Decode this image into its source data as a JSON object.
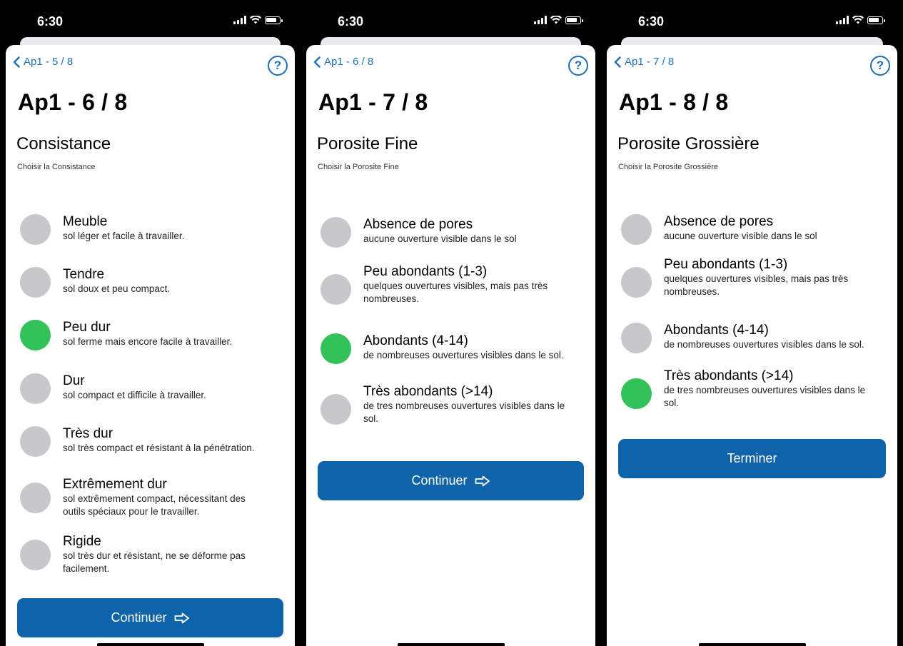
{
  "status": {
    "time": "6:30"
  },
  "screens": [
    {
      "back_label": "Ap1 - 5 / 8",
      "help_label": "?",
      "title": "Ap1 - 6 / 8",
      "section_title": "Consistance",
      "section_subtitle": "Choisir la Consistance",
      "button_label": "Continuer",
      "selected_option": "Peu dur",
      "options": [
        {
          "label": "Meuble",
          "desc": "sol léger et facile à travailler."
        },
        {
          "label": "Tendre",
          "desc": "sol doux et peu compact."
        },
        {
          "label": "Peu dur",
          "desc": "sol ferme mais encore facile à travailler."
        },
        {
          "label": "Dur",
          "desc": "sol compact et difficile à travailler."
        },
        {
          "label": "Très dur",
          "desc": "sol très compact et résistant à la pénétration."
        },
        {
          "label": "Extrêmement dur",
          "desc": "sol extrêmement compact, nécessitant des outils spéciaux pour le travailler."
        },
        {
          "label": "Rigide",
          "desc": "sol très dur et résistant, ne se déforme pas facilement."
        }
      ]
    },
    {
      "back_label": "Ap1 - 6 / 8",
      "help_label": "?",
      "title": "Ap1 - 7 / 8",
      "section_title": "Porosite Fine",
      "section_subtitle": "Choisir la Porosite Fine",
      "button_label": "Continuer",
      "selected_option": "Abondants (4-14)",
      "options": [
        {
          "label": "Absence de pores",
          "desc": "aucune ouverture visible dans le sol"
        },
        {
          "label": "Peu abondants (1-3)",
          "desc": "quelques ouvertures visibles, mais pas très nombreuses."
        },
        {
          "label": "Abondants (4-14)",
          "desc": "de nombreuses ouvertures visibles dans le sol."
        },
        {
          "label": "Très abondants (>14)",
          "desc": "de tres nombreuses ouvertures visibles dans le sol."
        }
      ]
    },
    {
      "back_label": "Ap1 - 7 / 8",
      "help_label": "?",
      "title": "Ap1 - 8 / 8",
      "section_title": "Porosite Grossière",
      "section_subtitle": "Choisir la Porosite Grossière",
      "button_label": "Terminer",
      "selected_option": "Très abondants (>14)",
      "options": [
        {
          "label": "Absence de pores",
          "desc": "aucune ouverture visible dans le sol"
        },
        {
          "label": "Peu abondants (1-3)",
          "desc": "quelques ouvertures visibles, mais pas très nombreuses."
        },
        {
          "label": "Abondants (4-14)",
          "desc": "de nombreuses ouvertures visibles dans le sol."
        },
        {
          "label": "Très abondants (>14)",
          "desc": "de tres nombreuses ouvertures visibles dans le sol."
        }
      ]
    }
  ],
  "colors": {
    "accent": "#1f6fb7",
    "button": "#0f63a9",
    "selected": "#33c15a",
    "unselected": "#c8c8ca"
  }
}
